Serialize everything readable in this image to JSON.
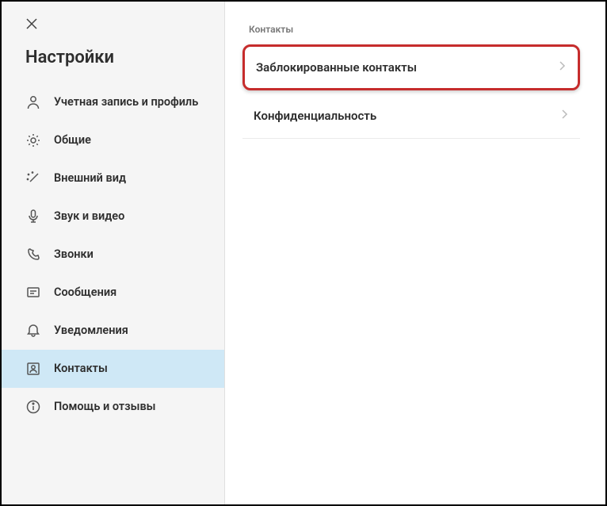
{
  "sidebar": {
    "title": "Настройки",
    "items": [
      {
        "label": "Учетная запись и профиль",
        "icon": "user"
      },
      {
        "label": "Общие",
        "icon": "gear"
      },
      {
        "label": "Внешний вид",
        "icon": "wand"
      },
      {
        "label": "Звук и видео",
        "icon": "mic"
      },
      {
        "label": "Звонки",
        "icon": "phone"
      },
      {
        "label": "Сообщения",
        "icon": "message"
      },
      {
        "label": "Уведомления",
        "icon": "bell"
      },
      {
        "label": "Контакты",
        "icon": "contact"
      },
      {
        "label": "Помощь и отзывы",
        "icon": "info"
      }
    ],
    "active_index": 7
  },
  "content": {
    "section_header": "Контакты",
    "rows": [
      {
        "label": "Заблокированные контакты",
        "highlighted": true
      },
      {
        "label": "Конфиденциальность",
        "highlighted": false
      }
    ]
  }
}
